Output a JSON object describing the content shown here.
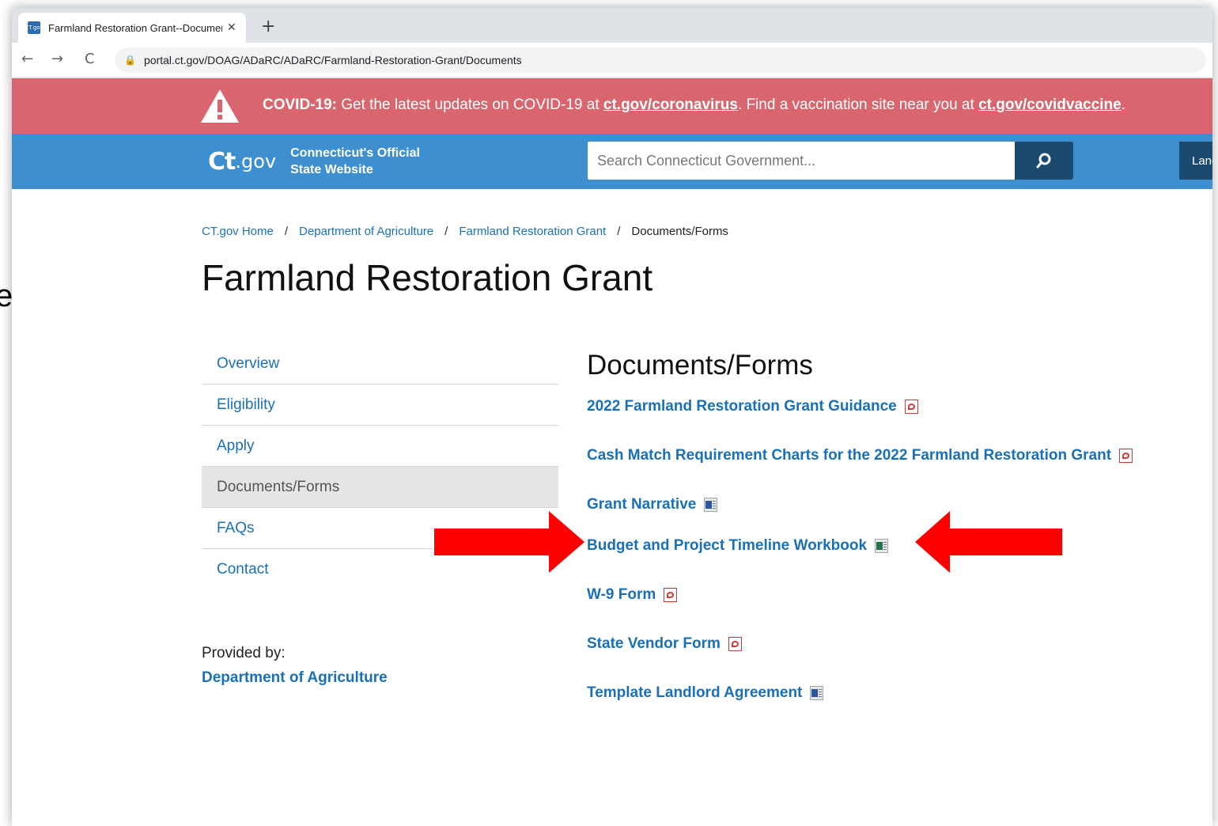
{
  "backdrop": {
    "letter": "e"
  },
  "browser": {
    "tab_title": "Farmland Restoration Grant--Documents",
    "favicon_text": "CT.gov",
    "tab_close": "✕",
    "new_tab": "+",
    "back": "←",
    "forward": "→",
    "reload": "C",
    "url": "portal.ct.gov/DOAG/ADaRC/ADaRC/Farmland-Restoration-Grant/Documents"
  },
  "covid_banner": {
    "label": "COVID-19:",
    "text_part1": " Get the latest updates on COVID-19 at ",
    "link1": "ct.gov/coronavirus",
    "text_part2": ".  Find a vaccination site near you at ",
    "link2": "ct.gov/covidvaccine",
    "text_part3": ".",
    "background": "#d9666e"
  },
  "header": {
    "logo_mark": "Ct",
    "logo_gov": ".gov",
    "logo_line1": "Connecticut's Official",
    "logo_line2": "State Website",
    "search_placeholder": "Search Connecticut Government...",
    "search_icon": "search-icon",
    "language_label": "Language",
    "background": "#3d8fcf"
  },
  "breadcrumb": {
    "items": [
      "CT.gov Home",
      "Department of Agriculture",
      "Farmland Restoration Grant"
    ],
    "separator": "/",
    "current": "Documents/Forms"
  },
  "page_title": "Farmland Restoration Grant",
  "sidenav": {
    "items": [
      {
        "label": "Overview"
      },
      {
        "label": "Eligibility"
      },
      {
        "label": "Apply"
      },
      {
        "label": "Documents/Forms",
        "active": true
      },
      {
        "label": "FAQs"
      },
      {
        "label": "Contact"
      }
    ]
  },
  "provided_by": {
    "label": "Provided by:",
    "agency": "Department of Agriculture"
  },
  "documents": {
    "heading": "Documents/Forms",
    "items": [
      {
        "label": "2022 Farmland Restoration Grant Guidance",
        "icon": "pdf-icon"
      },
      {
        "label": "Cash Match Requirement Charts for the 2022 Farmland Restoration Grant",
        "icon": "pdf-icon"
      },
      {
        "label": "Grant Narrative",
        "icon": "word-icon"
      },
      {
        "label": "Budget and Project Timeline Workbook",
        "icon": "excel-icon"
      },
      {
        "label": "W-9 Form",
        "icon": "pdf-icon"
      },
      {
        "label": "State Vendor Form",
        "icon": "pdf-icon"
      },
      {
        "label": "Template Landlord Agreement",
        "icon": "word-icon"
      }
    ]
  },
  "annotation": {
    "arrow_color": "#ff0000"
  }
}
